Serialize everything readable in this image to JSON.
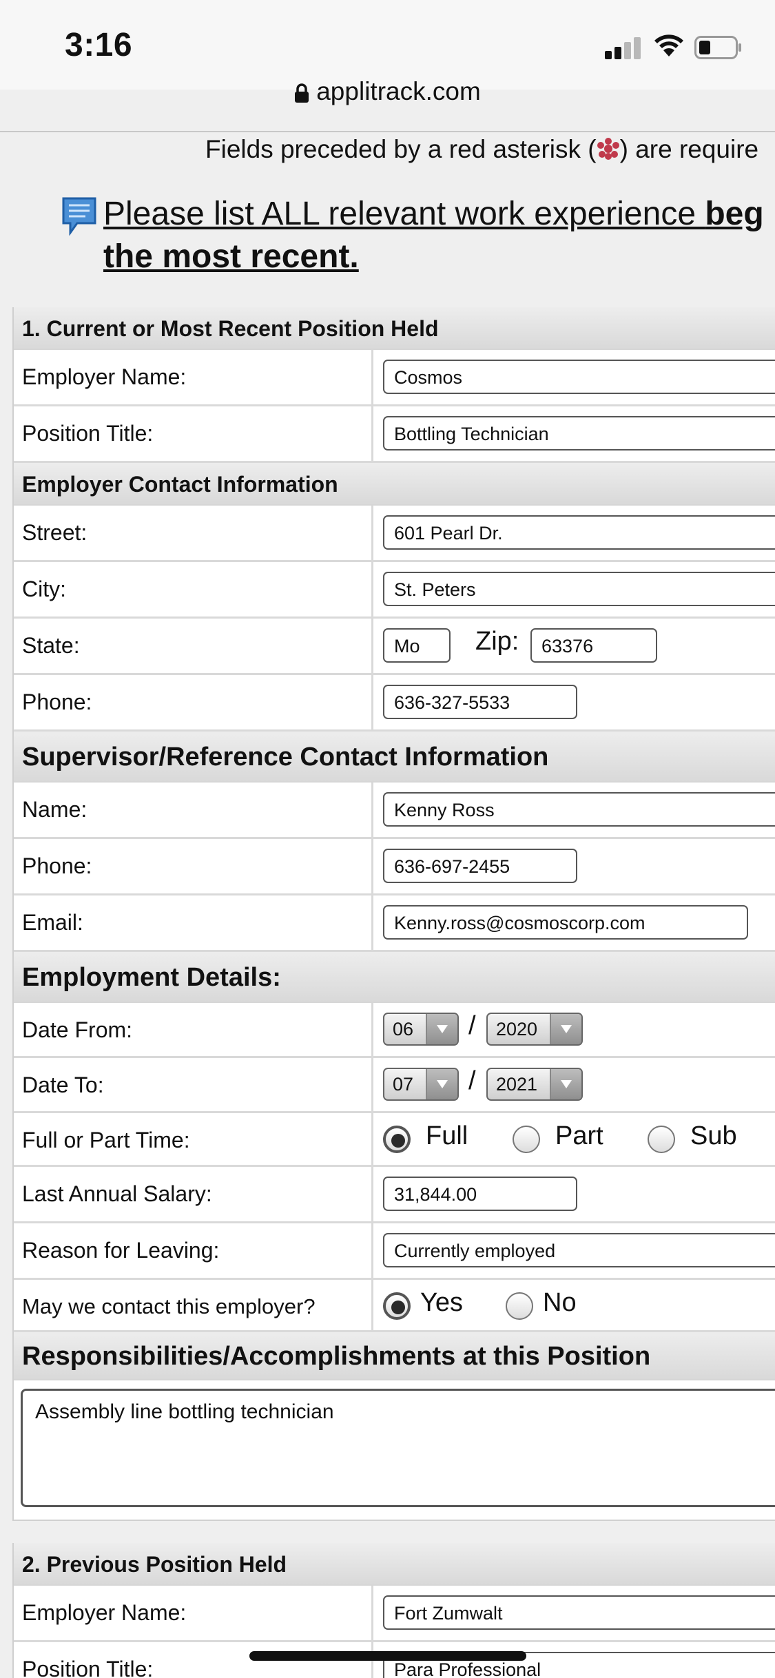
{
  "status_bar": {
    "time": "3:16"
  },
  "browser": {
    "domain": "applitrack.com"
  },
  "notice": {
    "prefix": "Fields preceded by a red asterisk (",
    "suffix": ") are require"
  },
  "instruction": {
    "line1_plain": "Please list ALL relevant work experience ",
    "line1_bold": "beg",
    "line2": "the most recent."
  },
  "section1": {
    "title": "1. Current or Most Recent Position Held",
    "employer_name": {
      "label": "Employer Name:",
      "value": "Cosmos"
    },
    "position_title": {
      "label": "Position Title:",
      "value": "Bottling Technician"
    },
    "contact_header": "Employer Contact Information",
    "street": {
      "label": "Street:",
      "value": "601 Pearl Dr."
    },
    "city": {
      "label": "City:",
      "value": "St. Peters"
    },
    "state": {
      "label": "State:",
      "value": "Mo",
      "zip_label": "Zip:",
      "zip_value": "63376"
    },
    "phone": {
      "label": "Phone:",
      "value": "636-327-5533"
    },
    "supervisor_header": "Supervisor/Reference Contact Information",
    "sup_name": {
      "label": "Name:",
      "value": "Kenny Ross"
    },
    "sup_phone": {
      "label": "Phone:",
      "value": "636-697-2455"
    },
    "sup_email": {
      "label": "Email:",
      "value": "Kenny.ross@cosmoscorp.com"
    },
    "details_header": "Employment Details:",
    "date_from": {
      "label": "Date From:",
      "month": "06",
      "year": "2020",
      "sep": "/"
    },
    "date_to": {
      "label": "Date To:",
      "month": "07",
      "year": "2021",
      "sep": "/"
    },
    "time_type": {
      "label": "Full or Part Time:",
      "options": [
        "Full",
        "Part",
        "Sub"
      ],
      "selected": "Full"
    },
    "salary": {
      "label": "Last Annual Salary:",
      "value": "31,844.00"
    },
    "reason": {
      "label": "Reason for Leaving:",
      "value": "Currently employed"
    },
    "contact_ok": {
      "label": "May we contact this employer?",
      "options": [
        "Yes",
        "No"
      ],
      "selected": "Yes"
    },
    "resp_header": "Responsibilities/Accomplishments at this Position",
    "resp_value": "Assembly line bottling  technician"
  },
  "section2": {
    "title": "2. Previous Position Held",
    "employer_name": {
      "label": "Employer Name:",
      "value": "Fort Zumwalt"
    },
    "position_title": {
      "label": "Position Title:",
      "value": "Para Professional"
    }
  },
  "colors": {
    "section_bg": "#dedede",
    "input_border": "#555555",
    "asterisk": "#c0394b"
  }
}
